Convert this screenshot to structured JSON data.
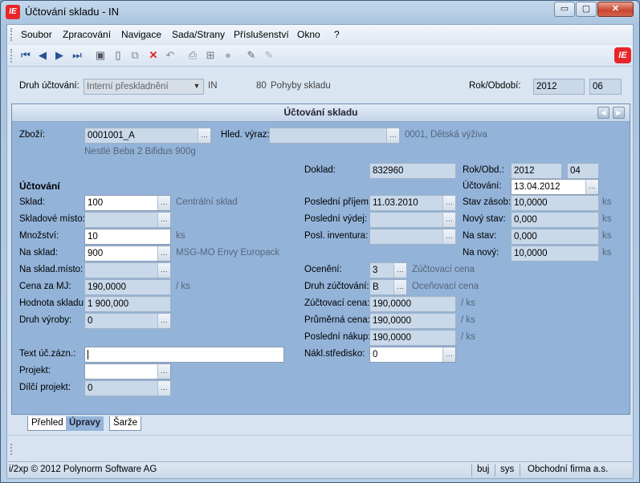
{
  "window": {
    "title": "Účtování skladu - IN",
    "app_icon": "IE",
    "min": "▭",
    "max": "▢",
    "close": "✕"
  },
  "menu": [
    "Soubor",
    "Zpracování",
    "Navigace",
    "Sada/Strany",
    "Příslušenství",
    "Okno",
    "?"
  ],
  "toolbar": {
    "icons": [
      "first-record-icon",
      "prev-record-icon",
      "next-record-icon",
      "last-record-icon",
      "save-icon",
      "new-icon",
      "copy-icon",
      "delete-icon",
      "undo-icon",
      "print-icon",
      "tree-icon",
      "circle-icon",
      "edit-pen-icon",
      "edit-pen-disabled-icon"
    ],
    "logo": "IE"
  },
  "header": {
    "druh_label": "Druh účtování:",
    "druh_value": "Interní přeskladnění",
    "druh_code": "IN",
    "druh_num": "80",
    "druh_desc": "Pohyby skladu",
    "rok_label": "Rok/Období:",
    "rok": "2012",
    "obdobi": "06"
  },
  "panel": {
    "title": "Účtování skladu"
  },
  "form": {
    "zbozi_label": "Zboží:",
    "zbozi": "0001001_A",
    "hled_label": "Hled. výraz:",
    "hled": "",
    "zbozi_group": "0001, Dětská výživa",
    "zbozi_name": "Nestlé Beba 2 Bifidus 900g",
    "doklad_label": "Doklad:",
    "doklad": "832960",
    "rokobd_label": "Rok/Obd.:",
    "rok": "2012",
    "obd": "04",
    "uctovani_head": "Účtování",
    "uctovani_label": "Účtování:",
    "uctovani_date": "13.04.2012",
    "sklad_label": "Sklad:",
    "sklad": "100",
    "sklad_name": "Centrální sklad",
    "skl_misto_label": "Skladové místo:",
    "skl_misto": "",
    "mnozstvi_label": "Množství:",
    "mnozstvi": "10",
    "mnozstvi_unit": "ks",
    "na_sklad_label": "Na sklad:",
    "na_sklad": "900",
    "na_sklad_name": "MSG-MO Envy Europack",
    "na_misto_label": "Na sklad.místo:",
    "na_misto": "",
    "cena_label": "Cena za MJ:",
    "cena": "190,0000",
    "cena_unit": "/ ks",
    "hodnota_label": "Hodnota skladu:",
    "hodnota": "1 900,000",
    "druh_vyroby_label": "Druh výroby:",
    "druh_vyroby": "0",
    "text_label": "Text úč.zázn.:",
    "text": "",
    "projekt_label": "Projekt:",
    "projekt": "",
    "dilci_label": "Dílčí projekt:",
    "dilci": "0",
    "posl_prijem_label": "Poslední příjem:",
    "posl_prijem": "11.03.2010",
    "posl_vydej_label": "Poslední výdej:",
    "posl_vydej": "",
    "posl_inv_label": "Posl. inventura:",
    "posl_inv": "",
    "oceneni_label": "Ocenění:",
    "oceneni": "3",
    "oceneni_desc": "Zúčtovací cena",
    "druh_zuct_label": "Druh zúčtování:",
    "druh_zuct": "B",
    "druh_zuct_desc": "Oceňovací cena",
    "zuct_cena_label": "Zúčtovací cena:",
    "zuct_cena": "190,0000",
    "zuct_unit": "/ ks",
    "prum_cena_label": "Průměrná cena:",
    "prum_cena": "190,0000",
    "prum_unit": "/ ks",
    "posl_nakup_label": "Poslední nákup:",
    "posl_nakup": "190,0000",
    "nakup_unit": "/ ks",
    "nakl_label": "Nákl.středisko:",
    "nakl": "0",
    "stav_zasob_label": "Stav zásob:",
    "stav_zasob": "10,0000",
    "stav_zasob_unit": "ks",
    "novy_stav_label": "Nový stav:",
    "novy_stav": "0,000",
    "novy_stav_unit": "ks",
    "na_stav_label": "Na stav:",
    "na_stav": "0,000",
    "na_stav_unit": "ks",
    "na_novy_label": "Na nový:",
    "na_novy": "10,0000",
    "na_novy_unit": "ks"
  },
  "tabs": [
    "Přehled",
    "Úpravy",
    "Šarže"
  ],
  "status": {
    "copyright": "i/2xp © 2012 Polynorm Software AG",
    "mode": "buj",
    "user": "sys",
    "company": "Obchodní firma a.s."
  }
}
